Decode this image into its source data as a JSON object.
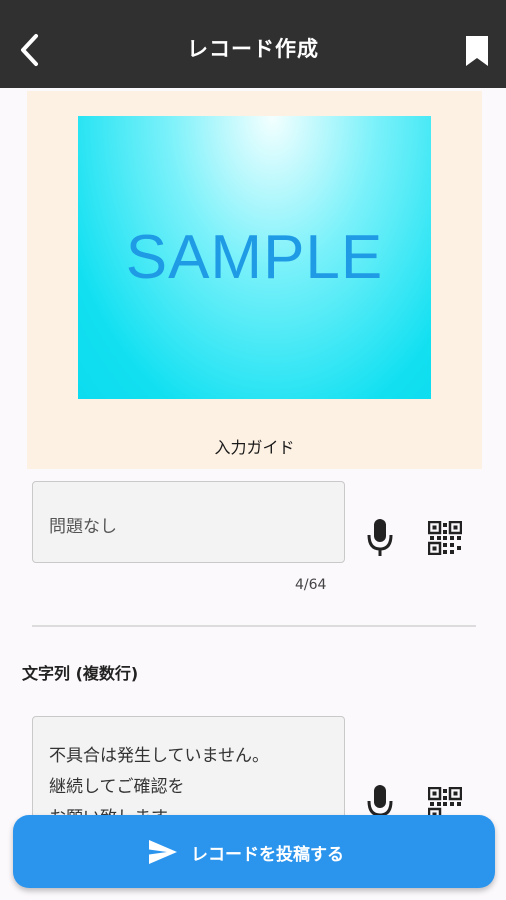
{
  "header": {
    "title": "レコード作成",
    "back_icon": "chevron-left-icon",
    "bookmark_icon": "bookmark-icon"
  },
  "guide": {
    "sample_text": "SAMPLE",
    "label": "入力ガイド"
  },
  "field1": {
    "value": "問題なし",
    "counter": "4/64",
    "mic_icon": "microphone-icon",
    "qr_icon": "qr-code-icon"
  },
  "field2": {
    "label": "文字列 (複数行)",
    "value_lines": [
      "不具合は発生していません。",
      "継続してご確認を",
      "お願い致します。"
    ],
    "mic_icon": "microphone-icon",
    "qr_icon": "qr-code-icon"
  },
  "submit": {
    "label": "レコードを投稿する",
    "icon": "send-icon"
  },
  "colors": {
    "header_bg": "#303030",
    "accent": "#2b95ee",
    "guide_bg": "#fdf1e3"
  }
}
